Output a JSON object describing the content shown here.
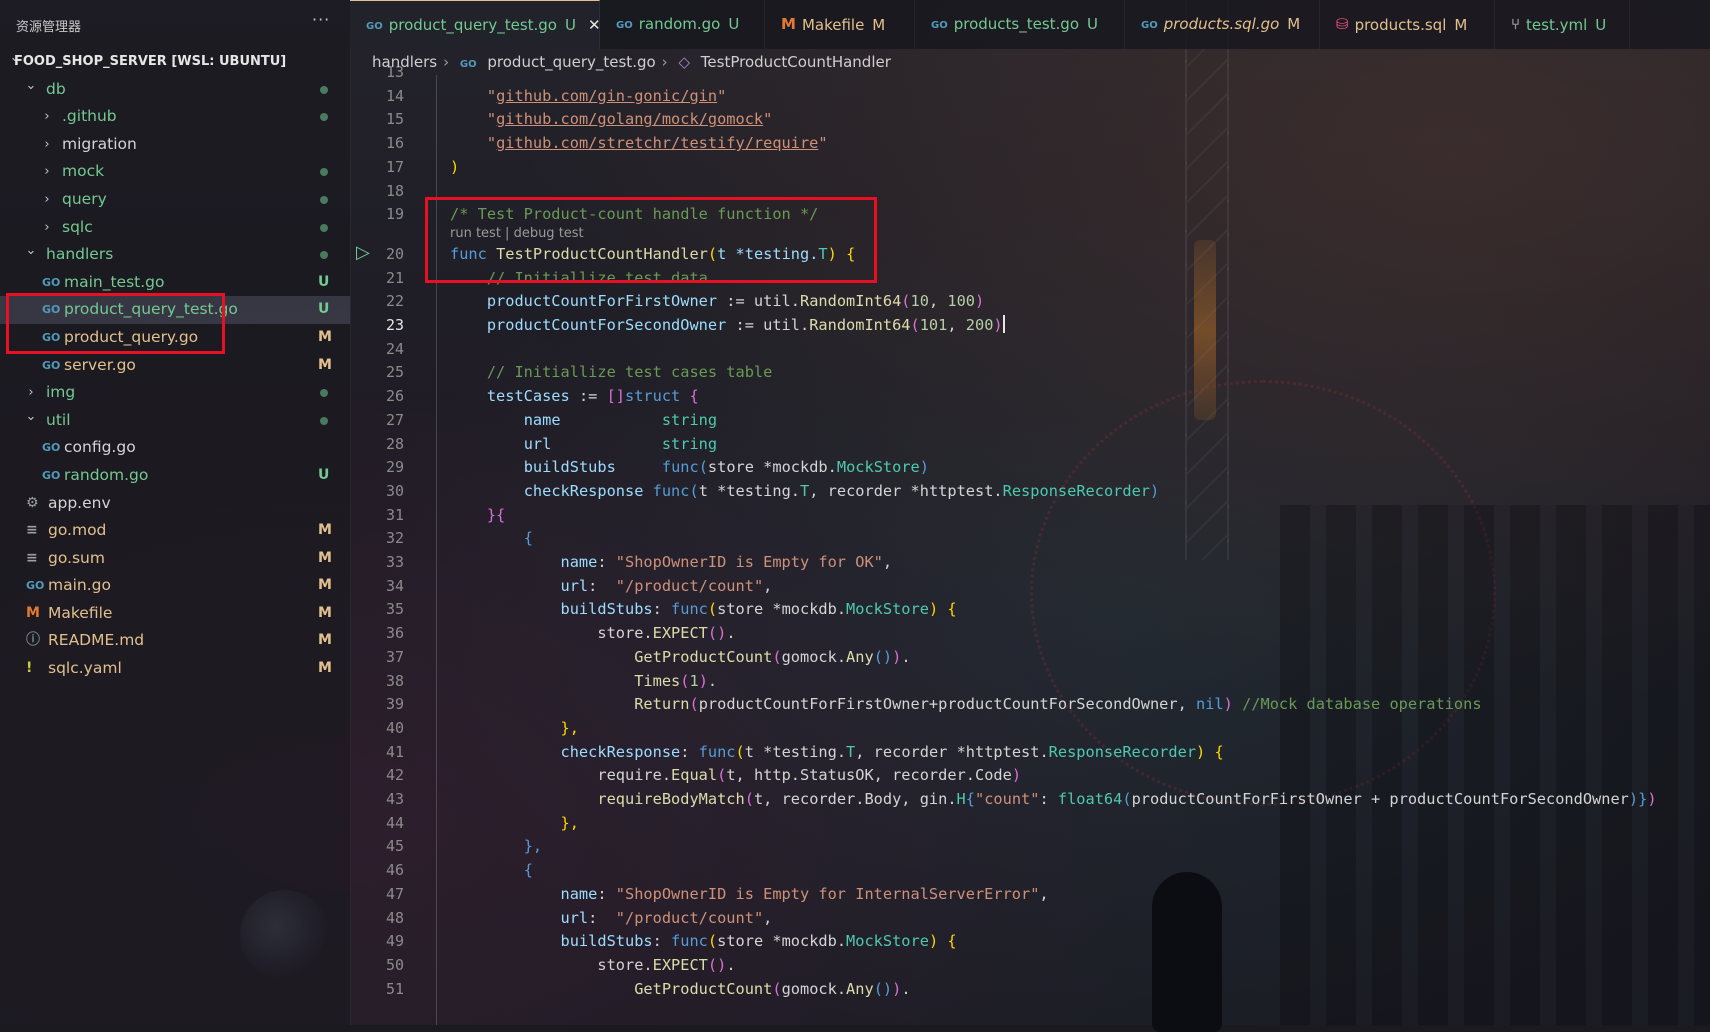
{
  "sidebar": {
    "title": "资源管理器",
    "more": "···",
    "items": [
      {
        "label": "FOOD_SHOP_SERVER [WSL: UBUNTU]",
        "chev": "v",
        "indent": 0,
        "icon": "",
        "status": ""
      },
      {
        "label": "db",
        "chev": "v",
        "indent": 1,
        "icon": "",
        "status": "dot"
      },
      {
        "label": ".github",
        "chev": ">",
        "indent": 2,
        "icon": "",
        "status": "dot"
      },
      {
        "label": "migration",
        "chev": ">",
        "indent": 2,
        "icon": "",
        "status": ""
      },
      {
        "label": "mock",
        "chev": ">",
        "indent": 2,
        "icon": "",
        "status": "dot"
      },
      {
        "label": "query",
        "chev": ">",
        "indent": 2,
        "icon": "",
        "status": "dot"
      },
      {
        "label": "sqlc",
        "chev": ">",
        "indent": 2,
        "icon": "",
        "status": "dot"
      },
      {
        "label": "handlers",
        "chev": "v",
        "indent": 1,
        "icon": "",
        "status": "dot"
      },
      {
        "label": "main_test.go",
        "chev": "",
        "indent": 2,
        "icon": "go",
        "status": "U"
      },
      {
        "label": "product_query_test.go",
        "chev": "",
        "indent": 2,
        "icon": "go",
        "status": "U",
        "selected": true
      },
      {
        "label": "product_query.go",
        "chev": "",
        "indent": 2,
        "icon": "go",
        "status": "M"
      },
      {
        "label": "server.go",
        "chev": "",
        "indent": 2,
        "icon": "go",
        "status": "M"
      },
      {
        "label": "img",
        "chev": ">",
        "indent": 1,
        "icon": "",
        "status": "dot"
      },
      {
        "label": "util",
        "chev": "v",
        "indent": 1,
        "icon": "",
        "status": "dot"
      },
      {
        "label": "config.go",
        "chev": "",
        "indent": 2,
        "icon": "go",
        "status": ""
      },
      {
        "label": "random.go",
        "chev": "",
        "indent": 2,
        "icon": "go",
        "status": "U"
      },
      {
        "label": "app.env",
        "chev": "",
        "indent": 1,
        "icon": "gear",
        "status": ""
      },
      {
        "label": "go.mod",
        "chev": "",
        "indent": 1,
        "icon": "lines",
        "status": "M"
      },
      {
        "label": "go.sum",
        "chev": "",
        "indent": 1,
        "icon": "lines",
        "status": "M"
      },
      {
        "label": "main.go",
        "chev": "",
        "indent": 1,
        "icon": "go",
        "status": "M"
      },
      {
        "label": "Makefile",
        "chev": "",
        "indent": 1,
        "icon": "makefile",
        "status": "M"
      },
      {
        "label": "README.md",
        "chev": "",
        "indent": 1,
        "icon": "info",
        "status": "M"
      },
      {
        "label": "sqlc.yaml",
        "chev": "",
        "indent": 1,
        "icon": "warn",
        "status": "M"
      }
    ]
  },
  "tabs": [
    {
      "label": "product_query_test.go",
      "status": "U",
      "icon": "go",
      "active": true,
      "close": "✕"
    },
    {
      "label": "random.go",
      "status": "U",
      "icon": "go"
    },
    {
      "label": "Makefile",
      "status": "M",
      "icon": "makefile"
    },
    {
      "label": "products_test.go",
      "status": "U",
      "icon": "go"
    },
    {
      "label": "products.sql.go",
      "status": "M",
      "icon": "go",
      "italic": true
    },
    {
      "label": "products.sql",
      "status": "M",
      "icon": "db"
    },
    {
      "label": "test.yml",
      "status": "U",
      "icon": "workflow"
    }
  ],
  "breadcrumb": {
    "folder": "handlers",
    "file": "product_query_test.go",
    "symbol": "TestProductCountHandler"
  },
  "editor": {
    "first_line": 13,
    "current_line": 23,
    "codelens": "run test | debug test",
    "codelens_line": 20,
    "lines": [
      [],
      [
        [
          "    ",
          ""
        ],
        [
          "\"",
          "s"
        ],
        [
          "github.com/gin-gonic/gin",
          "u"
        ],
        [
          "\"",
          "s"
        ]
      ],
      [
        [
          "    ",
          ""
        ],
        [
          "\"",
          "s"
        ],
        [
          "github.com/golang/mock/gomock",
          "u"
        ],
        [
          "\"",
          "s"
        ]
      ],
      [
        [
          "    ",
          ""
        ],
        [
          "\"",
          "s"
        ],
        [
          "github.com/stretchr/testify/require",
          "u"
        ],
        [
          "\"",
          "s"
        ]
      ],
      [
        [
          ")",
          "y"
        ]
      ],
      [],
      [
        [
          "/* Test Product-count handle function */",
          "c"
        ]
      ],
      [
        [
          "func",
          "k"
        ],
        [
          " ",
          ""
        ],
        [
          "TestProductCountHandler",
          "f"
        ],
        [
          "(",
          "y"
        ],
        [
          "t ",
          "v"
        ],
        [
          "*testing.",
          "v"
        ],
        [
          "T",
          "ty"
        ],
        [
          ")",
          "y"
        ],
        [
          " ",
          ""
        ],
        [
          "{",
          "y"
        ]
      ],
      [
        [
          "    ",
          ""
        ],
        [
          "// Initiallize test data",
          "c"
        ]
      ],
      [
        [
          "    ",
          ""
        ],
        [
          "productCountForFirstOwner",
          "v"
        ],
        [
          " := util.",
          ""
        ],
        [
          "RandomInt64",
          "f"
        ],
        [
          "(",
          "p"
        ],
        [
          "10",
          "n"
        ],
        [
          ", ",
          ""
        ],
        [
          "100",
          "n"
        ],
        [
          ")",
          "p"
        ]
      ],
      [
        [
          "    ",
          ""
        ],
        [
          "productCountForSecondOwner",
          "v"
        ],
        [
          " := util.",
          ""
        ],
        [
          "RandomInt64",
          "f"
        ],
        [
          "(",
          "p"
        ],
        [
          "101",
          "n"
        ],
        [
          ", ",
          ""
        ],
        [
          "200",
          "n"
        ],
        [
          ")",
          "p"
        ],
        [
          "|",
          "cursor"
        ]
      ],
      [],
      [
        [
          "    ",
          ""
        ],
        [
          "// Initiallize test cases table",
          "c"
        ]
      ],
      [
        [
          "    ",
          ""
        ],
        [
          "testCases",
          "v"
        ],
        [
          " := ",
          ""
        ],
        [
          "[]",
          "p"
        ],
        [
          "struct",
          "k"
        ],
        [
          " ",
          ""
        ],
        [
          "{",
          "p"
        ]
      ],
      [
        [
          "        ",
          ""
        ],
        [
          "name",
          "v"
        ],
        [
          "           ",
          ""
        ],
        [
          "string",
          "ty"
        ]
      ],
      [
        [
          "        ",
          ""
        ],
        [
          "url",
          "v"
        ],
        [
          "            ",
          ""
        ],
        [
          "string",
          "ty"
        ]
      ],
      [
        [
          "        ",
          ""
        ],
        [
          "buildStubs",
          "v"
        ],
        [
          "     ",
          ""
        ],
        [
          "func",
          "k"
        ],
        [
          "(",
          "k"
        ],
        [
          "store *mockdb.",
          ""
        ],
        [
          "MockStore",
          "ty"
        ],
        [
          ")",
          "k"
        ]
      ],
      [
        [
          "        ",
          ""
        ],
        [
          "checkResponse",
          "v"
        ],
        [
          " ",
          ""
        ],
        [
          "func",
          "k"
        ],
        [
          "(",
          "k"
        ],
        [
          "t *testing.",
          ""
        ],
        [
          "T",
          "ty"
        ],
        [
          ", recorder *httptest.",
          ""
        ],
        [
          "ResponseRecorder",
          "ty"
        ],
        [
          ")",
          "k"
        ]
      ],
      [
        [
          "    ",
          ""
        ],
        [
          "}{",
          "p"
        ]
      ],
      [
        [
          "        ",
          ""
        ],
        [
          "{",
          "k"
        ]
      ],
      [
        [
          "            ",
          ""
        ],
        [
          "name",
          "v"
        ],
        [
          ": ",
          ""
        ],
        [
          "\"ShopOwnerID is Empty for OK\"",
          "s"
        ],
        [
          ",",
          ""
        ]
      ],
      [
        [
          "            ",
          ""
        ],
        [
          "url",
          "v"
        ],
        [
          ":  ",
          ""
        ],
        [
          "\"/product/count\"",
          "s"
        ],
        [
          ",",
          ""
        ]
      ],
      [
        [
          "            ",
          ""
        ],
        [
          "buildStubs",
          "v"
        ],
        [
          ": ",
          ""
        ],
        [
          "func",
          "k"
        ],
        [
          "(",
          "y"
        ],
        [
          "store *mockdb.",
          ""
        ],
        [
          "MockStore",
          "ty"
        ],
        [
          ")",
          "y"
        ],
        [
          " ",
          ""
        ],
        [
          "{",
          "y"
        ]
      ],
      [
        [
          "                ",
          ""
        ],
        [
          "store.",
          ""
        ],
        [
          "EXPECT",
          "f"
        ],
        [
          "()",
          "p"
        ],
        [
          ".",
          ""
        ]
      ],
      [
        [
          "                    ",
          ""
        ],
        [
          "GetProductCount",
          "f"
        ],
        [
          "(",
          "p"
        ],
        [
          "gomock.",
          ""
        ],
        [
          "Any",
          "f"
        ],
        [
          "()",
          "k"
        ],
        [
          ")",
          "p"
        ],
        [
          ".",
          ""
        ]
      ],
      [
        [
          "                    ",
          ""
        ],
        [
          "Times",
          "f"
        ],
        [
          "(",
          "p"
        ],
        [
          "1",
          "n"
        ],
        [
          ")",
          "p"
        ],
        [
          ".",
          ""
        ]
      ],
      [
        [
          "                    ",
          ""
        ],
        [
          "Return",
          "f"
        ],
        [
          "(",
          "p"
        ],
        [
          "productCountForFirstOwner+productCountForSecondOwner, ",
          ""
        ],
        [
          "nil",
          "k"
        ],
        [
          ")",
          "p"
        ],
        [
          " ",
          ""
        ],
        [
          "//Mock database operations",
          "c"
        ]
      ],
      [
        [
          "            ",
          ""
        ],
        [
          "},",
          "y"
        ]
      ],
      [
        [
          "            ",
          ""
        ],
        [
          "checkResponse",
          "v"
        ],
        [
          ": ",
          ""
        ],
        [
          "func",
          "k"
        ],
        [
          "(",
          "y"
        ],
        [
          "t *testing.",
          ""
        ],
        [
          "T",
          "ty"
        ],
        [
          ", recorder *httptest.",
          ""
        ],
        [
          "ResponseRecorder",
          "ty"
        ],
        [
          ")",
          "y"
        ],
        [
          " ",
          ""
        ],
        [
          "{",
          "y"
        ]
      ],
      [
        [
          "                ",
          ""
        ],
        [
          "require.",
          ""
        ],
        [
          "Equal",
          "f"
        ],
        [
          "(",
          "p"
        ],
        [
          "t, http.StatusOK, recorder.Code",
          ""
        ],
        [
          ")",
          "p"
        ]
      ],
      [
        [
          "                ",
          ""
        ],
        [
          "requireBodyMatch",
          "f"
        ],
        [
          "(",
          "p"
        ],
        [
          "t, recorder.Body, gin.",
          ""
        ],
        [
          "H",
          "ty"
        ],
        [
          "{",
          "k"
        ],
        [
          "\"count\"",
          "s"
        ],
        [
          ": ",
          ""
        ],
        [
          "float64",
          "ty"
        ],
        [
          "(",
          "k"
        ],
        [
          "productCountForFirstOwner + productCountForSecondOwner",
          ""
        ],
        [
          ")",
          "k"
        ],
        [
          "}",
          "k"
        ],
        [
          ")",
          "p"
        ]
      ],
      [
        [
          "            ",
          ""
        ],
        [
          "},",
          "y"
        ]
      ],
      [
        [
          "        ",
          ""
        ],
        [
          "},",
          "k"
        ]
      ],
      [
        [
          "        ",
          ""
        ],
        [
          "{",
          "k"
        ]
      ],
      [
        [
          "            ",
          ""
        ],
        [
          "name",
          "v"
        ],
        [
          ": ",
          ""
        ],
        [
          "\"ShopOwnerID is Empty for InternalServerError\"",
          "s"
        ],
        [
          ",",
          ""
        ]
      ],
      [
        [
          "            ",
          ""
        ],
        [
          "url",
          "v"
        ],
        [
          ":  ",
          ""
        ],
        [
          "\"/product/count\"",
          "s"
        ],
        [
          ",",
          ""
        ]
      ],
      [
        [
          "            ",
          ""
        ],
        [
          "buildStubs",
          "v"
        ],
        [
          ": ",
          ""
        ],
        [
          "func",
          "k"
        ],
        [
          "(",
          "y"
        ],
        [
          "store *mockdb.",
          ""
        ],
        [
          "MockStore",
          "ty"
        ],
        [
          ")",
          "y"
        ],
        [
          " ",
          ""
        ],
        [
          "{",
          "y"
        ]
      ],
      [
        [
          "                ",
          ""
        ],
        [
          "store.",
          ""
        ],
        [
          "EXPECT",
          "f"
        ],
        [
          "()",
          "p"
        ],
        [
          ".",
          ""
        ]
      ],
      [
        [
          "                    ",
          ""
        ],
        [
          "GetProductCount",
          "f"
        ],
        [
          "(",
          "p"
        ],
        [
          "gomock.",
          ""
        ],
        [
          "Any",
          "f"
        ],
        [
          "()",
          "k"
        ],
        [
          ")",
          "p"
        ],
        [
          ".",
          ""
        ]
      ]
    ]
  }
}
